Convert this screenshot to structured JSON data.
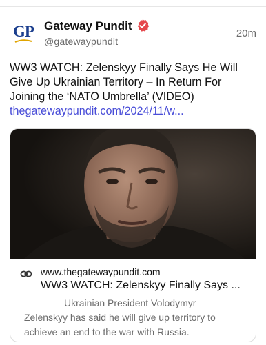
{
  "author": {
    "display_name": "Gateway Pundit",
    "handle": "@gatewaypundit",
    "avatar_text": "GP",
    "verified": true,
    "verified_color": "#e5484d",
    "brand_color": "#1c3f8e"
  },
  "post": {
    "time": "20m",
    "text": "WW3 WATCH: Zelenskyy Finally Says He Will Give Up Ukrainian Territory – In Return For Joining the ‘NATO Umbrella’ (VIDEO)",
    "link_text": "thegatewaypundit.com/2024/11/w...",
    "link_color": "#4a4ed8"
  },
  "card": {
    "icon": "link-icon",
    "domain": "www.thegatewaypundit.com",
    "title": "WW3 WATCH: Zelenskyy Finally Says ...",
    "description_line1": "Ukrainian President Volodymyr",
    "description_line2": "Zelenskyy has said he will give up territory to",
    "description_line3": "achieve an end to the war with Russia."
  }
}
